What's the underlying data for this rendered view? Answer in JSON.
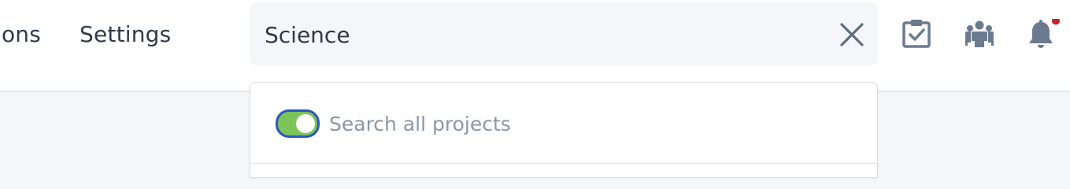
{
  "nav": {
    "items": [
      {
        "label": "ions"
      },
      {
        "label": "Settings"
      }
    ]
  },
  "search": {
    "value": "Science",
    "clear_icon": "close-icon"
  },
  "dropdown": {
    "toggle": {
      "label": "Search all projects",
      "enabled": true
    }
  },
  "header_icons": [
    {
      "name": "tasks-clipboard-icon"
    },
    {
      "name": "team-icon"
    },
    {
      "name": "notification-bell-icon",
      "has_unread": true
    }
  ],
  "colors": {
    "text": "#2f3a48",
    "icon": "#6b7a8f",
    "toggle_on": "#7cc35a",
    "toggle_border": "#2b56c5",
    "notification_dot": "#c0262d",
    "muted_text": "#8a96a8"
  }
}
